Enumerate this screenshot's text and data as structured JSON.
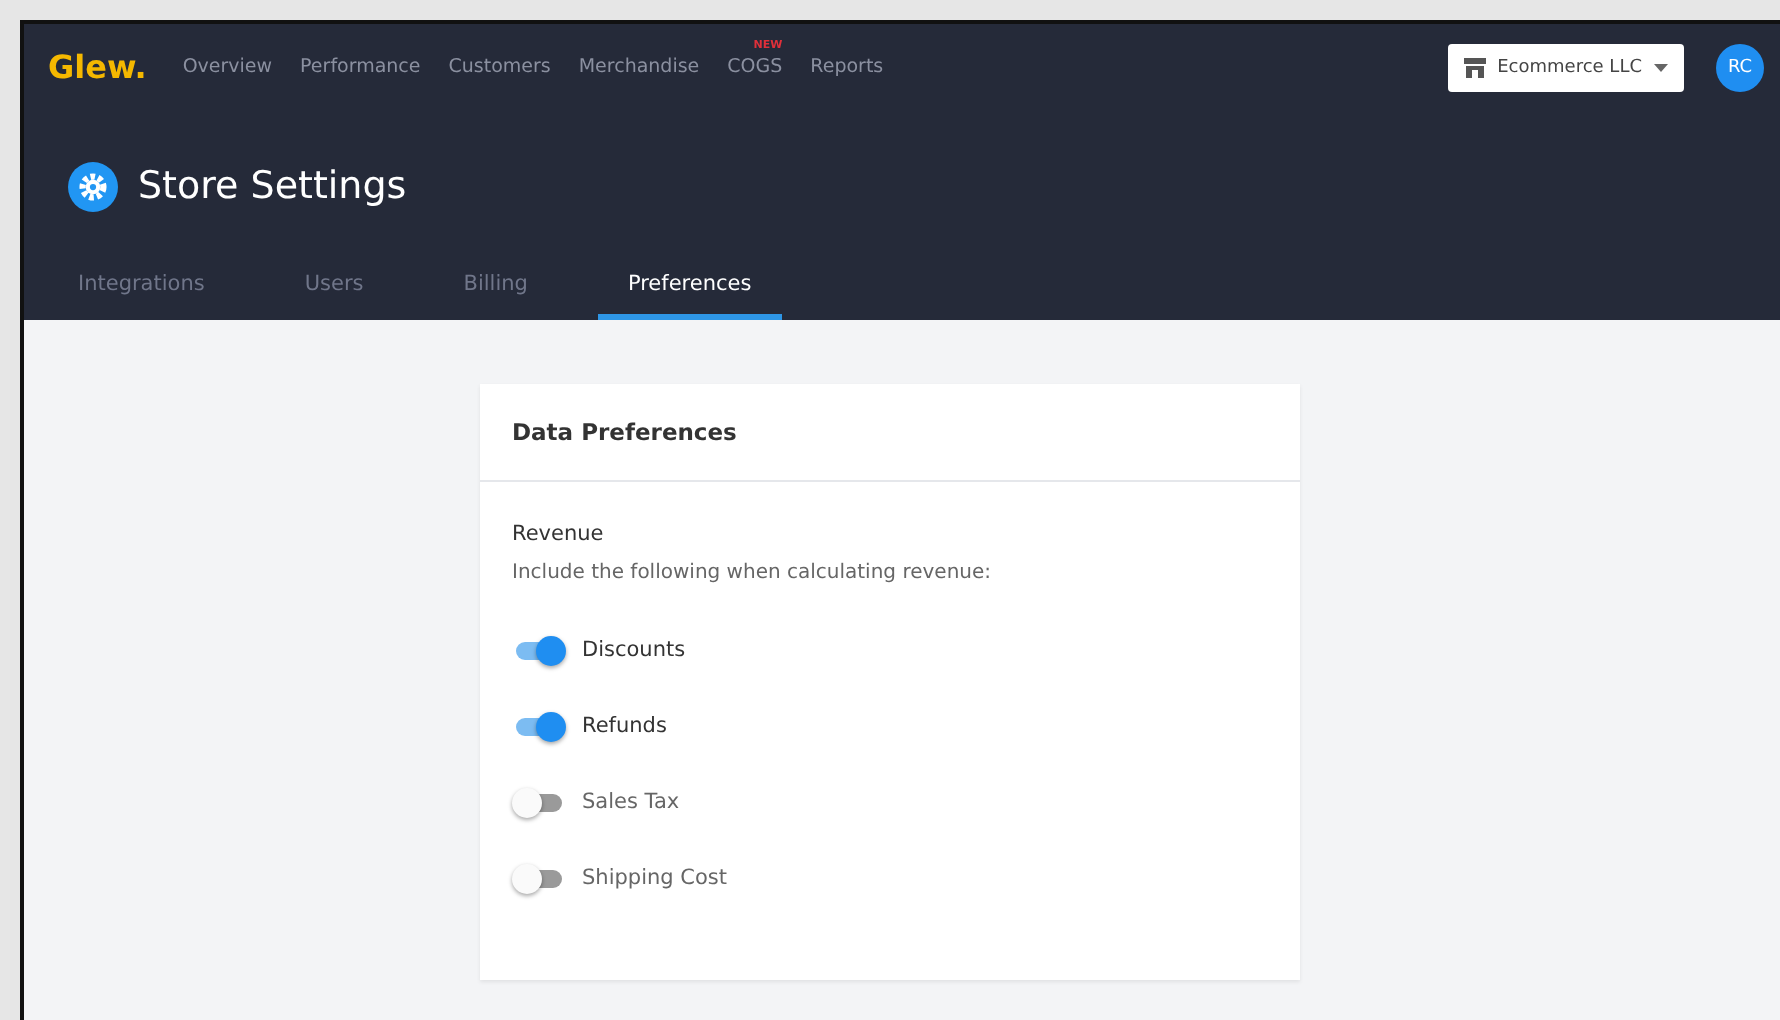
{
  "brand": "Glew.",
  "nav": [
    {
      "label": "Overview"
    },
    {
      "label": "Performance"
    },
    {
      "label": "Customers"
    },
    {
      "label": "Merchandise"
    },
    {
      "label": "COGS",
      "badge": "NEW"
    },
    {
      "label": "Reports"
    }
  ],
  "store_selector": "Ecommerce LLC",
  "avatar": "RC",
  "page_title": "Store Settings",
  "tabs": [
    {
      "label": "Integrations",
      "selected": false
    },
    {
      "label": "Users",
      "selected": false
    },
    {
      "label": "Billing",
      "selected": false
    },
    {
      "label": "Preferences",
      "selected": true
    }
  ],
  "card": {
    "title": "Data Preferences",
    "section": "Revenue",
    "description": "Include the following when calculating revenue:",
    "toggles": [
      {
        "label": "Discounts",
        "on": true
      },
      {
        "label": "Refunds",
        "on": true
      },
      {
        "label": "Sales Tax",
        "on": false
      },
      {
        "label": "Shipping Cost",
        "on": false
      }
    ]
  }
}
